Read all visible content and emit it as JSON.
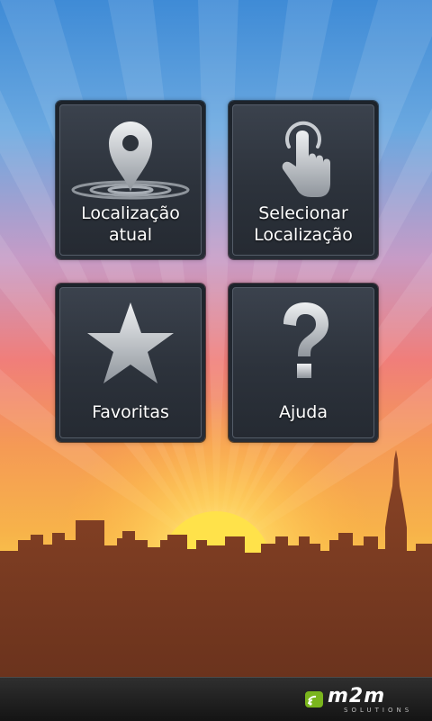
{
  "menu": {
    "current_location": {
      "label": "Localização\natual",
      "icon": "location-pin-icon"
    },
    "select_location": {
      "label": "Selecionar\nLocalização",
      "icon": "tap-finger-icon"
    },
    "favorites": {
      "label": "Favoritas",
      "icon": "star-icon"
    },
    "help": {
      "label": "Ajuda",
      "icon": "question-mark-icon"
    }
  },
  "footer": {
    "brand_name": "m2m",
    "brand_tagline": "SOLUTIONS"
  },
  "colors": {
    "tile_background": "#2f353e",
    "tile_border": "#545c68",
    "icon_light": "#e6e8ea",
    "icon_dark": "#8e939a",
    "brand_green": "#7ab51d",
    "skyline": "#7a3a22"
  }
}
